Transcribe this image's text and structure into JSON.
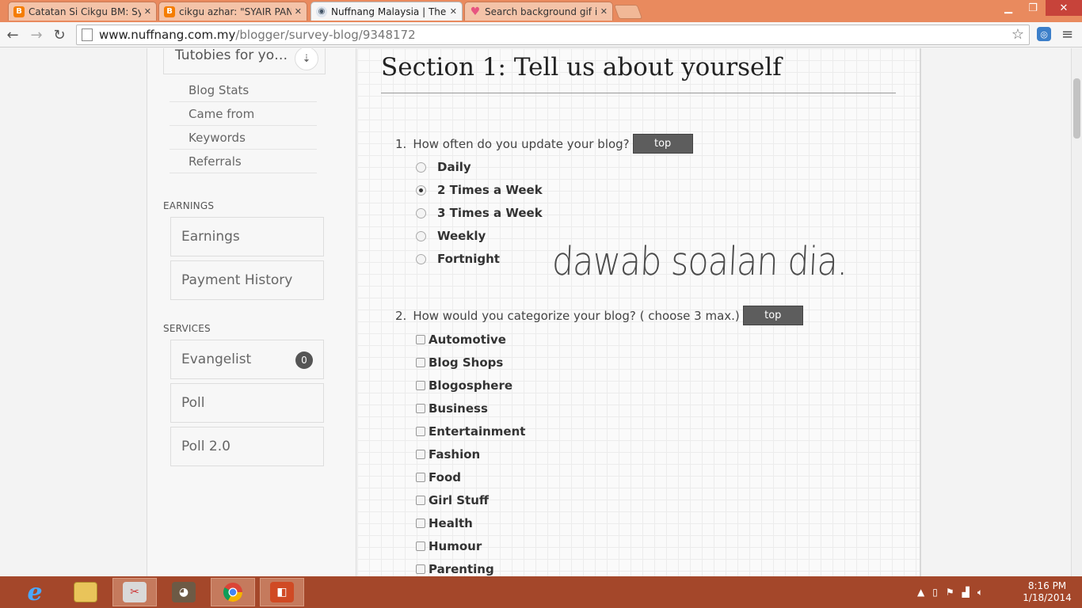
{
  "browser": {
    "tabs": [
      {
        "title": "Catatan Si Cikgu BM: Syair",
        "favicon": "blogger-icon"
      },
      {
        "title": "cikgu azhar: \"SYAIR PAND",
        "favicon": "blogger-icon"
      },
      {
        "title": "Nuffnang Malaysia | The W",
        "favicon": "nuffnang-icon"
      },
      {
        "title": "Search background gif im",
        "favicon": "heart-icon"
      }
    ],
    "url_host": "www.nuffnang.com.my",
    "url_path": "/blogger/survey-blog/9348172"
  },
  "sidebar": {
    "selector_label": "Tutobies for yo…",
    "blog_links": [
      "Blog Stats",
      "Came from",
      "Keywords",
      "Referrals"
    ],
    "earnings_heading": "EARNINGS",
    "earnings_items": [
      "Earnings",
      "Payment History"
    ],
    "services_heading": "SERVICES",
    "services_items": [
      "Evangelist",
      "Poll",
      "Poll 2.0"
    ],
    "evangelist_badge": "0"
  },
  "main": {
    "section_title": "Section 1: Tell us about yourself",
    "top_label": "top",
    "q1": {
      "number": "1.",
      "text": "How often do you update your blog?",
      "options": [
        "Daily",
        "2 Times a Week",
        "3 Times a Week",
        "Weekly",
        "Fortnight"
      ],
      "selected": 1
    },
    "q2": {
      "number": "2.",
      "text": "How would you categorize your blog? ( choose 3 max.)",
      "options": [
        "Automotive",
        "Blog Shops",
        "Blogosphere",
        "Business",
        "Entertainment",
        "Fashion",
        "Food",
        "Girl Stuff",
        "Health",
        "Humour",
        "Parenting"
      ]
    },
    "annotation": "dawab soalan dia."
  },
  "taskbar": {
    "time": "8:16 PM",
    "date": "1/18/2014"
  },
  "colors": {
    "tabbar": "#e98a5e",
    "taskbar": "#a4472a",
    "top_button": "#5d5d5d"
  }
}
